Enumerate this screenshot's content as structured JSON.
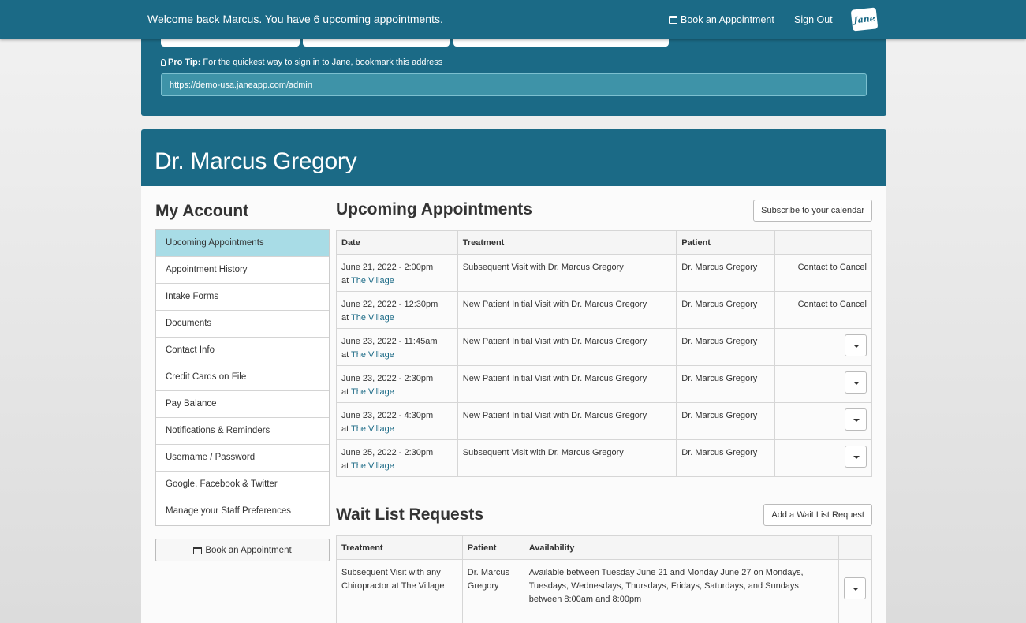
{
  "topbar": {
    "welcome": "Welcome back Marcus. You have 6 upcoming appointments.",
    "book_label": "Book an Appointment",
    "signout_label": "Sign Out",
    "logo_text": "Jane"
  },
  "promo": {
    "tip_label": "Pro Tip:",
    "tip_text": "For the quickest way to sign in to Jane, bookmark this address",
    "url": "https://demo-usa.janeapp.com/admin"
  },
  "profile": {
    "name": "Dr. Marcus Gregory"
  },
  "sidebar": {
    "title": "My Account",
    "items": [
      {
        "label": "Upcoming Appointments"
      },
      {
        "label": "Appointment History"
      },
      {
        "label": "Intake Forms"
      },
      {
        "label": "Documents"
      },
      {
        "label": "Contact Info"
      },
      {
        "label": "Credit Cards on File"
      },
      {
        "label": "Pay Balance"
      },
      {
        "label": "Notifications & Reminders"
      },
      {
        "label": "Username / Password"
      },
      {
        "label": "Google, Facebook & Twitter"
      },
      {
        "label": "Manage your Staff Preferences"
      }
    ],
    "book_label": "Book an Appointment"
  },
  "appointments": {
    "title": "Upcoming Appointments",
    "subscribe_label": "Subscribe to your calendar",
    "headers": {
      "date": "Date",
      "treatment": "Treatment",
      "patient": "Patient"
    },
    "rows": [
      {
        "date": "June 21, 2022 - 2:00pm",
        "at": "at",
        "location": "The Village",
        "treatment": "Subsequent Visit with Dr. Marcus Gregory",
        "patient": "Dr. Marcus Gregory",
        "action": "Contact to Cancel"
      },
      {
        "date": "June 22, 2022 - 12:30pm",
        "at": "at",
        "location": "The Village",
        "treatment": "New Patient Initial Visit with Dr. Marcus Gregory",
        "patient": "Dr. Marcus Gregory",
        "action": "Contact to Cancel"
      },
      {
        "date": "June 23, 2022 - 11:45am",
        "at": "at",
        "location": "The Village",
        "treatment": "New Patient Initial Visit with Dr. Marcus Gregory",
        "patient": "Dr. Marcus Gregory",
        "action": ""
      },
      {
        "date": "June 23, 2022 - 2:30pm",
        "at": "at",
        "location": "The Village",
        "treatment": "New Patient Initial Visit with Dr. Marcus Gregory",
        "patient": "Dr. Marcus Gregory",
        "action": ""
      },
      {
        "date": "June 23, 2022 - 4:30pm",
        "at": "at",
        "location": "The Village",
        "treatment": "New Patient Initial Visit with Dr. Marcus Gregory",
        "patient": "Dr. Marcus Gregory",
        "action": ""
      },
      {
        "date": "June 25, 2022 - 2:30pm",
        "at": "at",
        "location": "The Village",
        "treatment": "Subsequent Visit with Dr. Marcus Gregory",
        "patient": "Dr. Marcus Gregory",
        "action": ""
      }
    ]
  },
  "waitlist": {
    "title": "Wait List Requests",
    "add_label": "Add a Wait List Request",
    "headers": {
      "treatment": "Treatment",
      "patient": "Patient",
      "availability": "Availability"
    },
    "rows": [
      {
        "treatment": "Subsequent Visit with any Chiropractor at The Village",
        "patient": "Dr. Marcus Gregory",
        "availability": "Available between Tuesday June 21 and Monday June 27 on Mondays, Tuesdays, Wednesdays, Thursdays, Fridays, Saturdays, and Sundays between 8:00am and 8:00pm"
      }
    ]
  },
  "colors": {
    "brand": "#1b6a86",
    "active_menu": "#a8dce6",
    "link": "#1b6a86"
  }
}
